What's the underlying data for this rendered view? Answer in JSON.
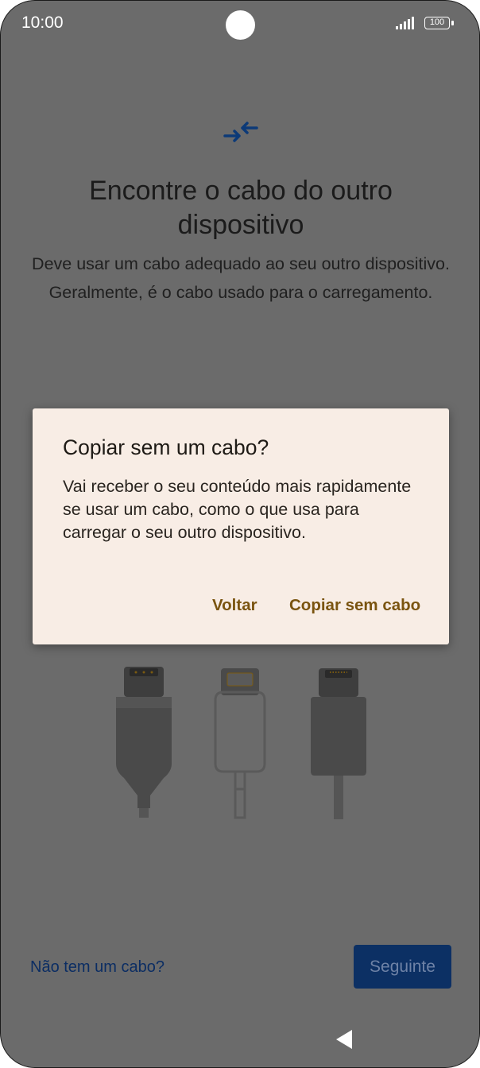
{
  "status_bar": {
    "time": "10:00",
    "battery": "100",
    "icons": [
      "camera-cutout",
      "signal-icon",
      "battery-icon"
    ]
  },
  "main": {
    "icon": "transfer-arrows-icon",
    "title_line1": "Encontre o cabo do outro",
    "title_line2": "dispositivo",
    "subtitle": "Deve usar um cabo adequado ao seu outro dispositivo. Geralmente, é o cabo usado para o carregamento.",
    "illustration": "cables-illustration"
  },
  "footer": {
    "no_cable_link": "Não tem um cabo?",
    "next_button": "Seguinte"
  },
  "nav_bar": {
    "back_icon": "back-triangle-icon"
  },
  "dialog": {
    "title": "Copiar sem um cabo?",
    "body": "Vai receber o seu conteúdo mais rapidamente se usar um cabo, como o que usa para carregar o seu outro dispositivo.",
    "back_button": "Voltar",
    "copy_button": "Copiar sem cabo"
  },
  "colors": {
    "scrim_background": "#6b6b6b",
    "dialog_background": "#f8ede5",
    "dialog_button": "#7a5410",
    "primary_button": "#0c3064",
    "link": "#0b2d63",
    "icon_accent": "#0c3a78"
  }
}
